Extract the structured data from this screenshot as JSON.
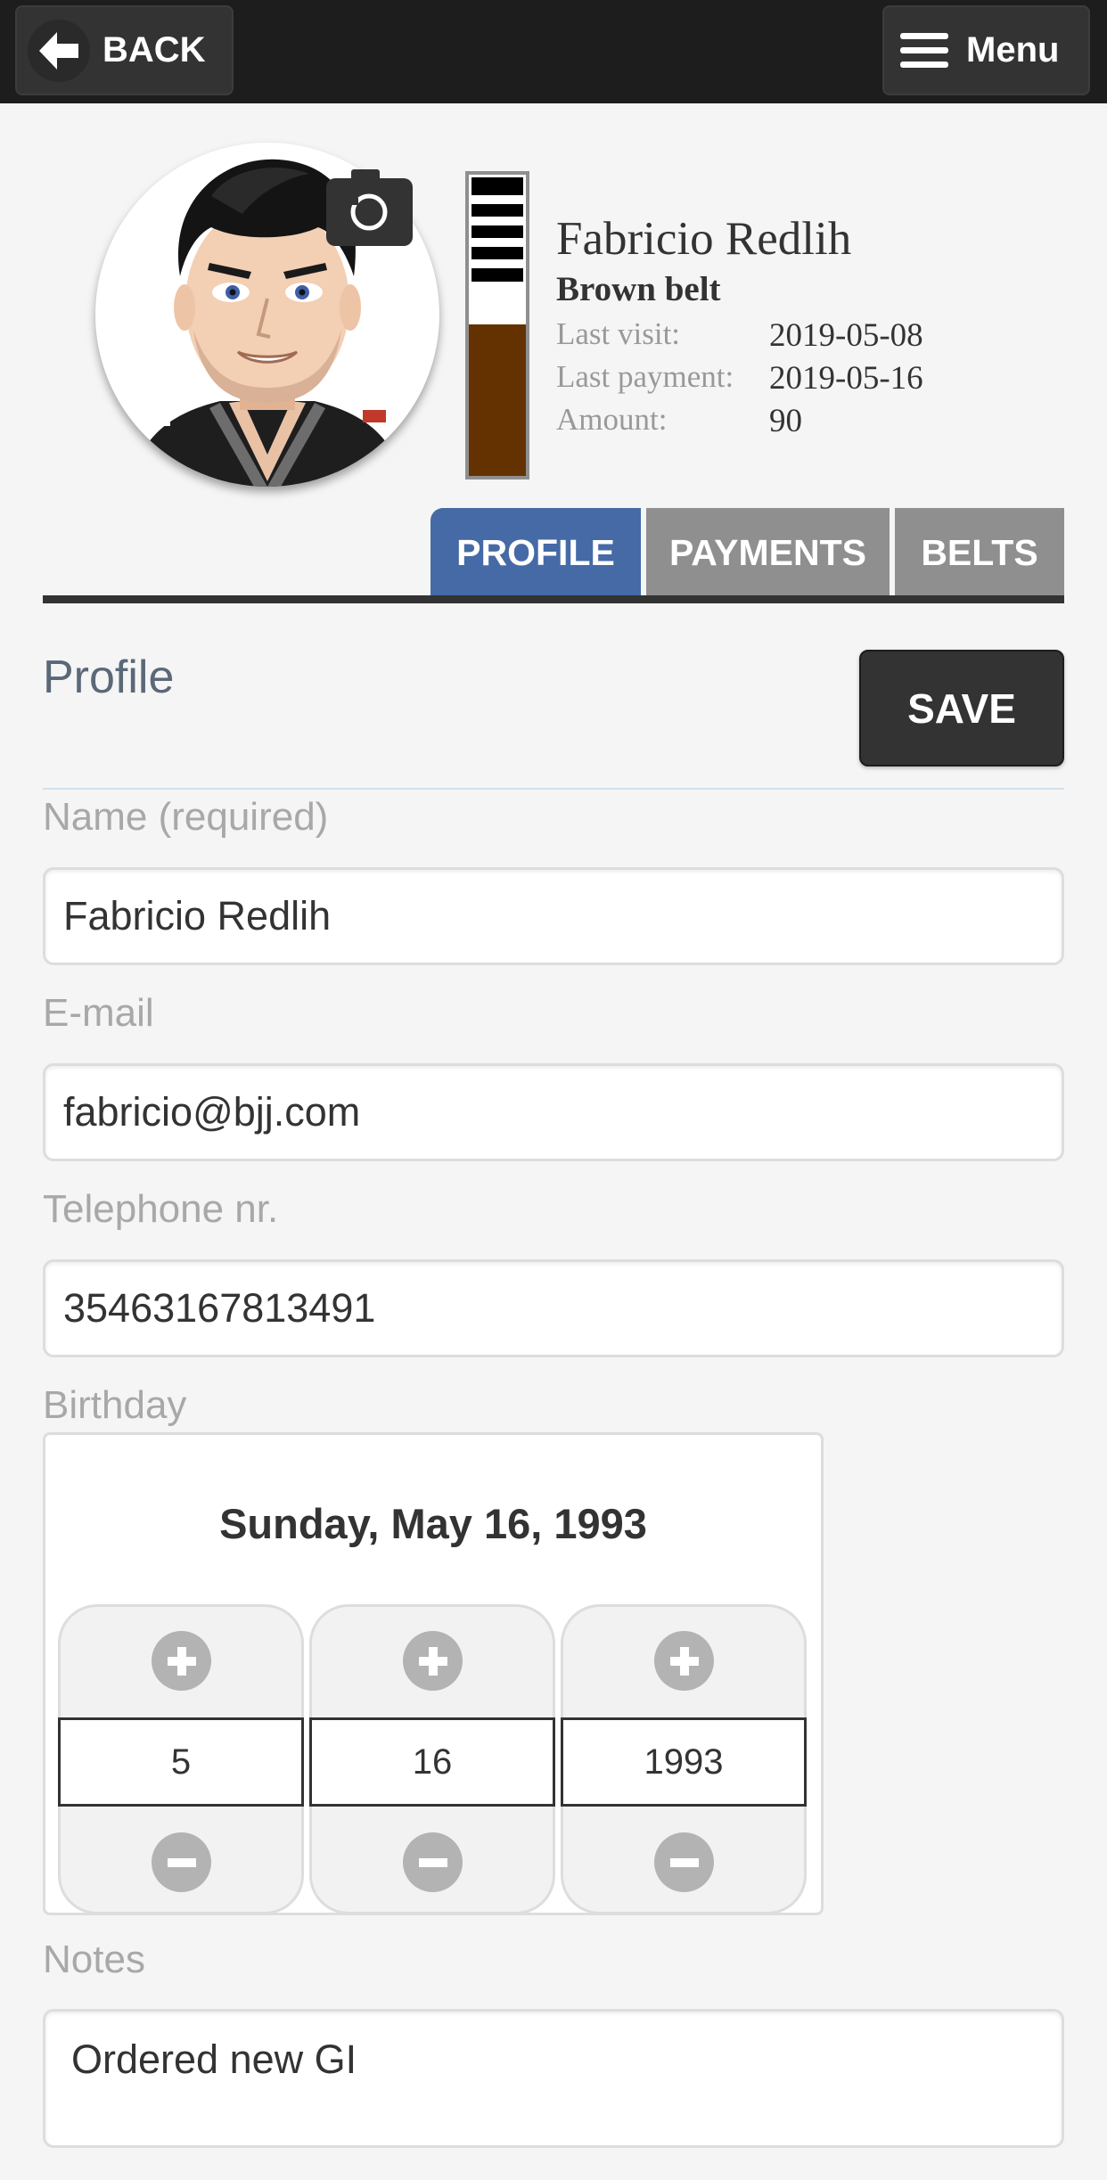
{
  "header": {
    "back_label": "BACK",
    "menu_label": "Menu"
  },
  "member": {
    "name": "Fabricio Redlih",
    "belt": "Brown belt",
    "belt_color": "#643200",
    "belt_stripes": 4,
    "stats": [
      {
        "label": "Last visit:",
        "value": "2019-05-08"
      },
      {
        "label": "Last payment:",
        "value": "2019-05-16"
      },
      {
        "label": "Amount:",
        "value": "90"
      }
    ]
  },
  "tabs": [
    {
      "label": "PROFILE",
      "active": true
    },
    {
      "label": "PAYMENTS",
      "active": false
    },
    {
      "label": "BELTS",
      "active": false
    }
  ],
  "profile": {
    "title": "Profile",
    "save_label": "SAVE",
    "fields": {
      "name": {
        "label": "Name (required)",
        "value": "Fabricio Redlih"
      },
      "email": {
        "label": "E-mail",
        "value": "fabricio@bjj.com"
      },
      "phone": {
        "label": "Telephone nr.",
        "value": "35463167813491"
      }
    },
    "birthday": {
      "label": "Birthday",
      "display": "Sunday, May 16, 1993",
      "month": "5",
      "day": "16",
      "year": "1993"
    },
    "notes": {
      "label": "Notes",
      "value": "Ordered new GI"
    }
  },
  "colors": {
    "accent": "#456aa6",
    "tab_inactive": "#8f8f8f",
    "header": "#1d1d1d"
  },
  "icons": {
    "back": "arrow-left-icon",
    "menu": "hamburger-icon",
    "camera": "camera-icon",
    "plus": "plus-icon",
    "minus": "minus-icon"
  }
}
